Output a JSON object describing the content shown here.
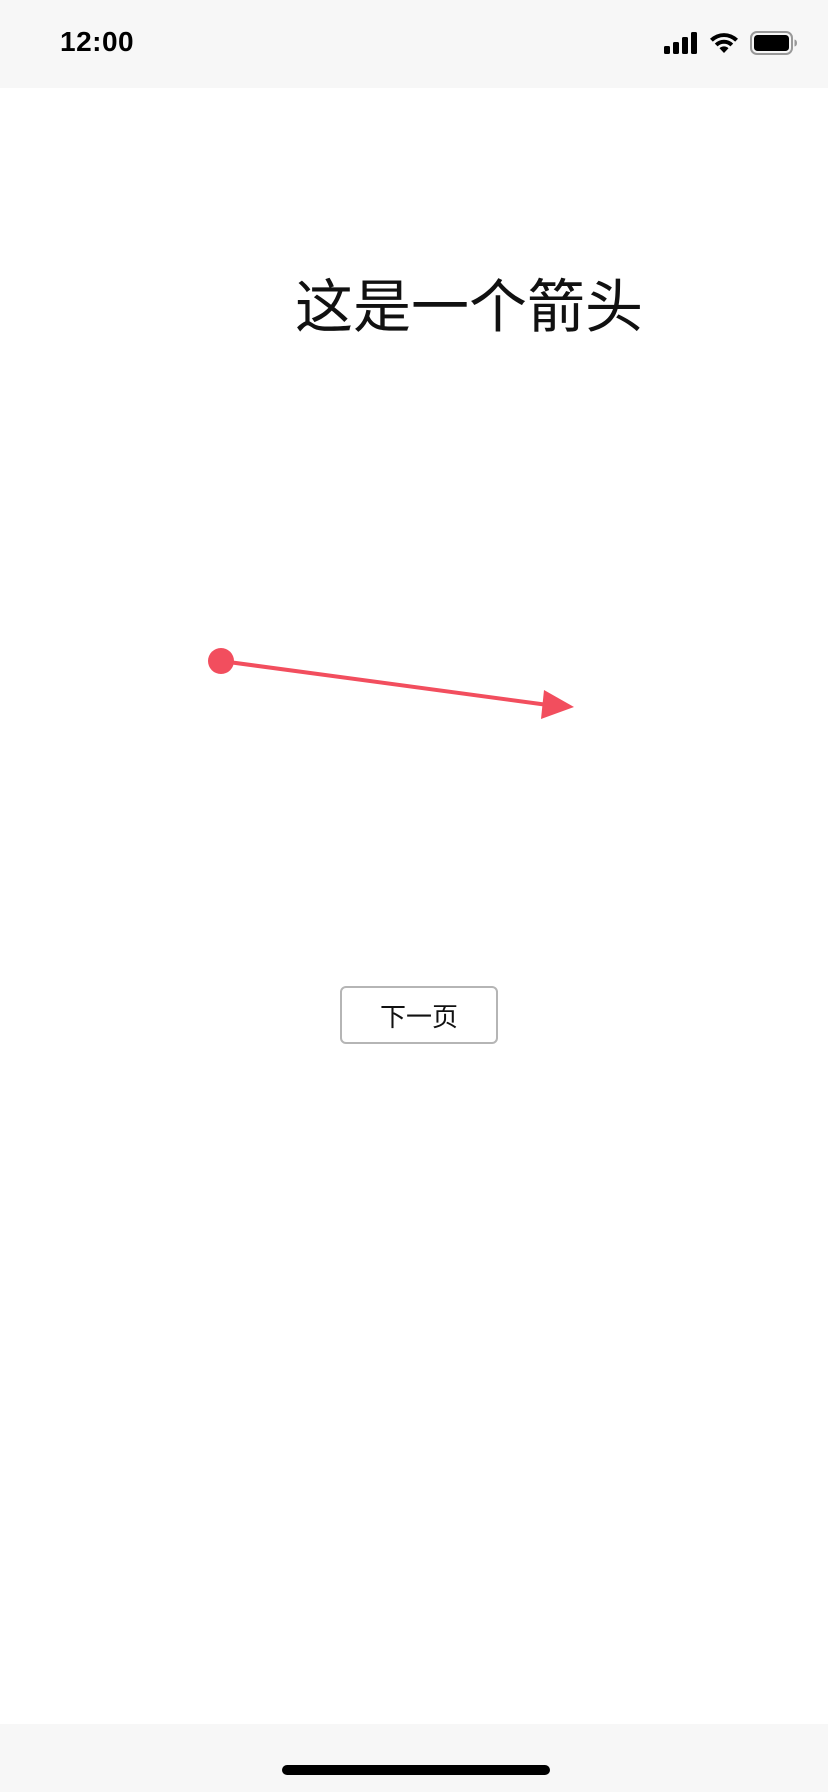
{
  "status_bar": {
    "time": "12:00",
    "icons": [
      "cellular-signal-icon",
      "wifi-icon",
      "battery-icon"
    ]
  },
  "main": {
    "title": "这是一个箭头",
    "next_button_label": "下一页"
  },
  "colors": {
    "arrow": "#f24e5e",
    "status_bar_bg": "#f7f7f7",
    "background": "#ffffff"
  }
}
